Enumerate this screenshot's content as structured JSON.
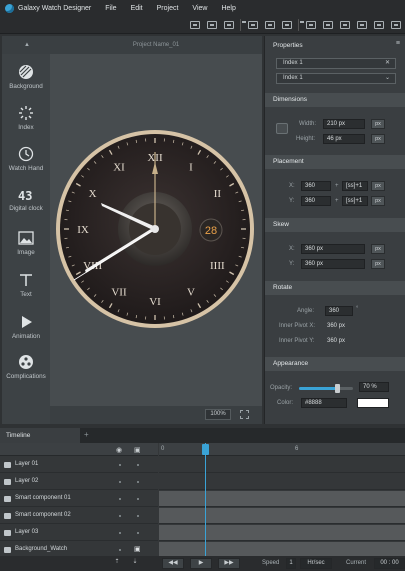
{
  "menubar": {
    "app_title": "Galaxy Watch Designer",
    "items": [
      "File",
      "Edit",
      "Project",
      "View",
      "Help"
    ]
  },
  "canvas": {
    "project_name": "Project Name_01",
    "zoom": "100%",
    "date_number": "28",
    "numerals": [
      "XII",
      "I",
      "II",
      "III",
      "IIII",
      "V",
      "VI",
      "VII",
      "VIII",
      "IX",
      "X",
      "XI"
    ]
  },
  "tools": [
    {
      "label": "Background",
      "icon": "background-icon"
    },
    {
      "label": "Index",
      "icon": "index-icon"
    },
    {
      "label": "Watch Hand",
      "icon": "clock-icon"
    },
    {
      "label": "Digital clock",
      "icon": "digital-clock-icon"
    },
    {
      "label": "Image",
      "icon": "image-icon"
    },
    {
      "label": "Text",
      "icon": "text-icon"
    },
    {
      "label": "Animation",
      "icon": "play-icon"
    },
    {
      "label": "Complications",
      "icon": "complications-icon"
    }
  ],
  "properties": {
    "title": "Properties",
    "selectors": [
      "Index 1",
      "Index 1"
    ],
    "dimensions": {
      "title": "Dimensions",
      "width_label": "Width:",
      "width": "210 px",
      "height_label": "Height:",
      "height": "46 px",
      "unit": "px"
    },
    "placement": {
      "title": "Placement",
      "x_label": "X:",
      "x": "360",
      "y_label": "Y:",
      "y": "360",
      "plus": "+",
      "ss": "[ss]+1",
      "unit": "px"
    },
    "skew": {
      "title": "Skew",
      "x_label": "X:",
      "x": "360 px",
      "y_label": "Y:",
      "y": "360 px",
      "unit": "px"
    },
    "rotate": {
      "title": "Rotate",
      "angle_label": "Angle:",
      "angle": "360",
      "degree": "°",
      "pivot_x_label": "Inner Pivot X:",
      "pivot_x": "360 px",
      "pivot_y_label": "Inner Pivot Y:",
      "pivot_y": "360 px"
    },
    "appearance": {
      "title": "Appearance",
      "opacity_label": "Opacity:",
      "opacity": "70 %",
      "opacity_value": 0.7,
      "color_label": "Color:",
      "color": "#8888",
      "swatch_color": "#ffffff"
    }
  },
  "timeline": {
    "tab": "Timeline",
    "add": "+",
    "ruler_marks": [
      "0",
      "6"
    ],
    "layers": [
      {
        "name": "Layer 01",
        "filled": false
      },
      {
        "name": "Layer 02",
        "filled": false
      },
      {
        "name": "Smart component 01",
        "filled": true
      },
      {
        "name": "Smart component 02",
        "filled": true
      },
      {
        "name": "Layer 03",
        "filled": true
      },
      {
        "name": "Background_Watch",
        "filled": true
      }
    ],
    "speed_label": "Speed",
    "speed_value": "1",
    "speed_unit": "Hr/sec",
    "current_label": "Current",
    "current_value": "00 : 00"
  }
}
